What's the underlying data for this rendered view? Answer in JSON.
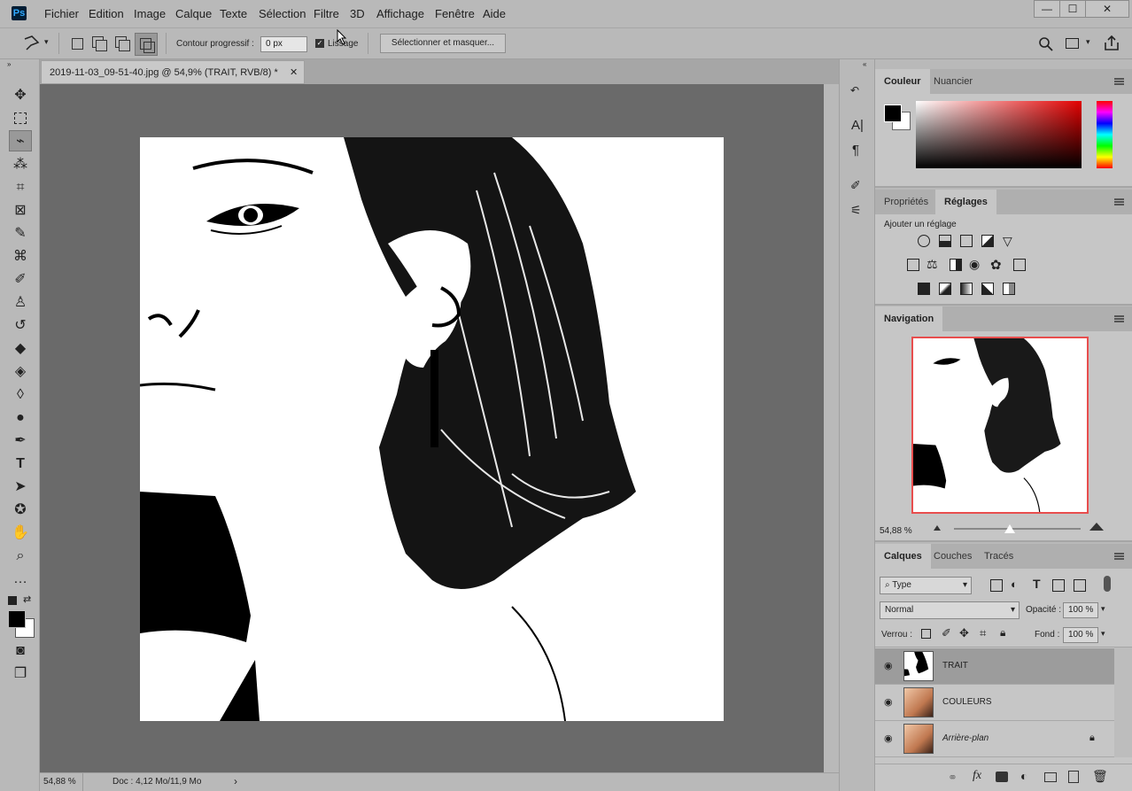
{
  "menubar": {
    "logo": "Ps",
    "items": [
      "Fichier",
      "Edition",
      "Image",
      "Calque",
      "Texte",
      "Sélection",
      "Filtre",
      "3D",
      "Affichage",
      "Fenêtre",
      "Aide"
    ],
    "window_buttons": [
      "—",
      "☐",
      "✕"
    ]
  },
  "options": {
    "feather_label": "Contour progressif :",
    "feather_value": "0 px",
    "antialias_label": "Lissage",
    "select_mask_label": "Sélectionner et masquer..."
  },
  "document": {
    "tab_title": "2019-11-03_09-51-40.jpg @ 54,9% (TRAIT, RVB/8) *",
    "tab_close": "✕",
    "zoom": "54,88 %",
    "doc_info": "Doc : 4,12 Mo/11,9 Mo",
    "status_arrow": "›"
  },
  "panels": {
    "color": {
      "tabs": [
        "Couleur",
        "Nuancier"
      ]
    },
    "adjust": {
      "tabs": [
        "Propriétés",
        "Réglages"
      ],
      "add_label": "Ajouter un réglage"
    },
    "navigation": {
      "tab": "Navigation",
      "zoom": "54,88 %"
    },
    "layers": {
      "tabs": [
        "Calques",
        "Couches",
        "Tracés"
      ],
      "filter_type": "Type",
      "blend_mode": "Normal",
      "opacity_label": "Opacité :",
      "opacity_value": "100 %",
      "lock_label": "Verrou :",
      "fill_label": "Fond :",
      "fill_value": "100 %",
      "items": [
        {
          "name": "TRAIT",
          "selected": true
        },
        {
          "name": "COULEURS",
          "selected": false
        },
        {
          "name": "Arrière-plan",
          "selected": false,
          "locked": true
        }
      ],
      "bottom_icons": [
        "link-icon",
        "fx-icon",
        "mask-icon",
        "adjustment-icon",
        "group-icon",
        "new-layer-icon",
        "trash-icon"
      ],
      "fx_label": "fx"
    }
  },
  "colors": {
    "accent_nav": "#e84e4e",
    "foreground": "#000000",
    "background": "#ffffff"
  }
}
